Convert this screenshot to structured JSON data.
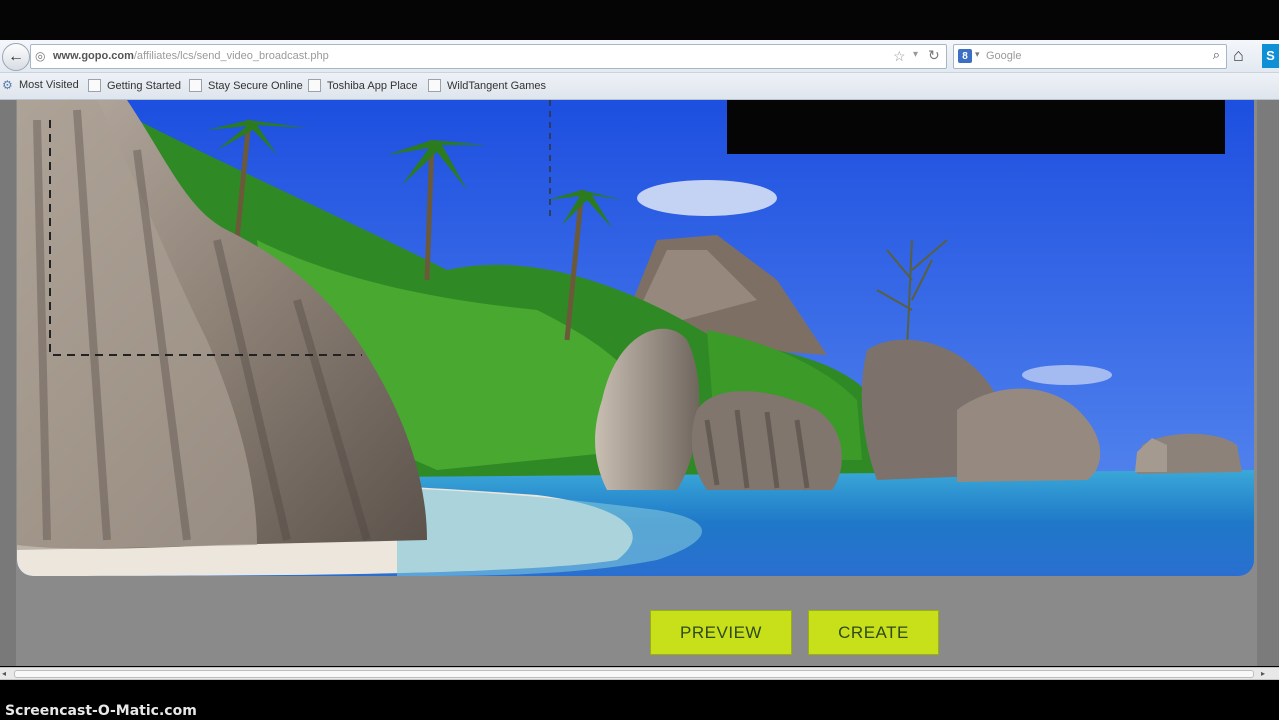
{
  "browser": {
    "url_domain": "www.gopo.com",
    "url_path": "/affiliates/lcs/send_video_broadcast.php",
    "search_placeholder": "Google",
    "search_engine_letter": "8"
  },
  "bookmarks": [
    {
      "label": "Most Visited"
    },
    {
      "label": "Getting Started"
    },
    {
      "label": "Stay Secure Online"
    },
    {
      "label": "Toshiba App Place"
    },
    {
      "label": "WildTangent Games"
    }
  ],
  "actions": {
    "preview_label": "PREVIEW",
    "create_label": "CREATE"
  },
  "watermark": "Screencast-O-Matic.com",
  "colors": {
    "button_bg": "#c8e01a",
    "button_text": "#2d4a1a",
    "page_bg": "#8a8a8a"
  },
  "icons": [
    "back-arrow-icon",
    "globe-icon",
    "star-icon",
    "reload-icon",
    "search-icon",
    "home-icon",
    "skype-icon",
    "gear-icon"
  ]
}
